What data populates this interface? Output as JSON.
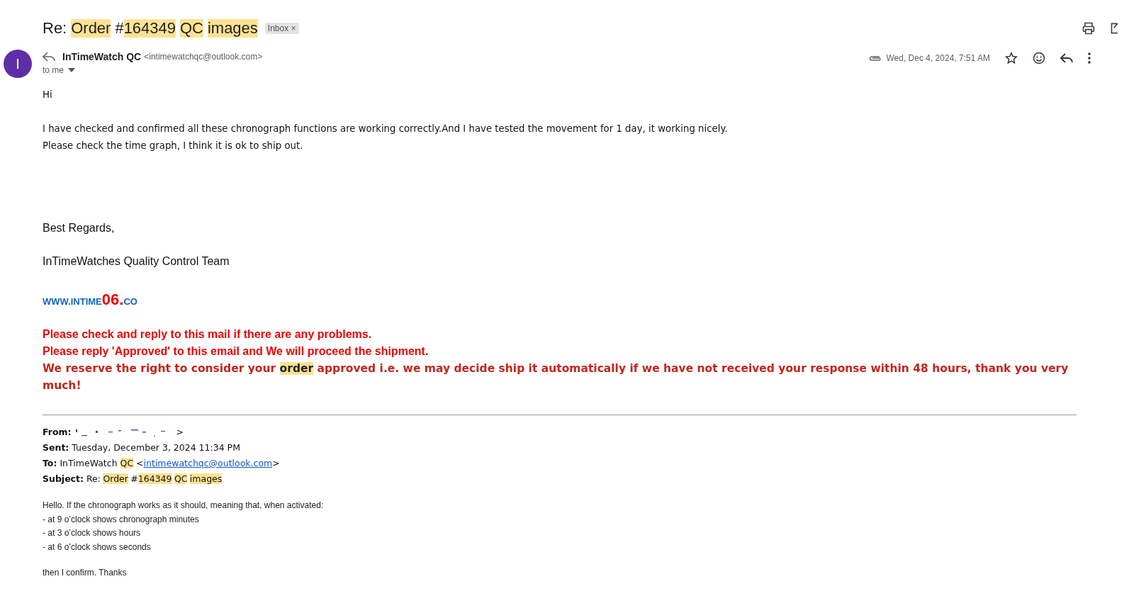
{
  "subject": [
    {
      "text": "Re:",
      "highlighted": false
    },
    {
      "text": "Order",
      "highlighted": true
    },
    {
      "text": "#",
      "highlighted": false
    },
    {
      "text": "164349",
      "highlighted": true
    },
    {
      "text": "QC",
      "highlighted": true
    },
    {
      "text": "images",
      "highlighted": true
    }
  ],
  "label_chip": {
    "label": "Inbox",
    "close": "×"
  },
  "sender": {
    "avatar": "I",
    "name": "InTimeWatch QC",
    "email": "<intimewatchqc@outlook.com>",
    "recipient": "to me"
  },
  "date": "Wed, Dec 4, 2024, 7:51 AM",
  "body": {
    "greeting": "Hi",
    "paragraph": [
      "I have checked and confirmed all these chronograph functions are working correctly.And I have tested the movement for 1 day, it working nicely.",
      "Please check the time graph, I think it is ok to ship out."
    ],
    "regards": "Best Regards,",
    "team": "InTimeWatches Quality Control Team",
    "website": [
      {
        "text": "WWW.INTIME",
        "kind": "small"
      },
      {
        "text": "06",
        "kind": "big"
      },
      {
        "text": ".",
        "kind": "big"
      },
      {
        "text": "CO",
        "kind": "small"
      }
    ],
    "notices": [
      "Please check and reply to this mail if there are any problems.",
      "Please reply 'Approved' to this email and We will proceed the shipment."
    ],
    "warning": [
      {
        "text": "We reserve the right to consider your ",
        "highlighted": false
      },
      {
        "text": "order",
        "highlighted": true
      },
      {
        "text": " approved i.e. we may decide ship it automatically if we have not received your response within 48 hours, thank you very much!",
        "highlighted": false
      }
    ]
  },
  "quoted": {
    "from": {
      "label": "From:",
      "value": ">"
    },
    "sent": {
      "label": "Sent:",
      "value": "Tuesday, December 3, 2024 11:34 PM"
    },
    "to": {
      "label": "To:",
      "name": "InTimeWatch",
      "name_highlight": "QC",
      "link_open": "<",
      "link": "intimewatchqc@outlook.com",
      "link_close": ">"
    },
    "subject": {
      "label": "Subject:",
      "parts": [
        {
          "text": "Re:",
          "highlighted": false
        },
        {
          "text": "Order",
          "highlighted": true
        },
        {
          "text": "#",
          "highlighted": false
        },
        {
          "text": "164349",
          "highlighted": true
        },
        {
          "text": "QC",
          "highlighted": true
        },
        {
          "text": "images",
          "highlighted": true
        }
      ]
    },
    "lines": [
      "Hello. If the chronograph works as it should, meaning that, when activated:",
      "- at 9 o’clock shows chronograph minutes",
      "- at 3 o’clock shows hours",
      "- at 6 o’clock shows seconds"
    ],
    "closing": "then I confirm. Thanks"
  }
}
